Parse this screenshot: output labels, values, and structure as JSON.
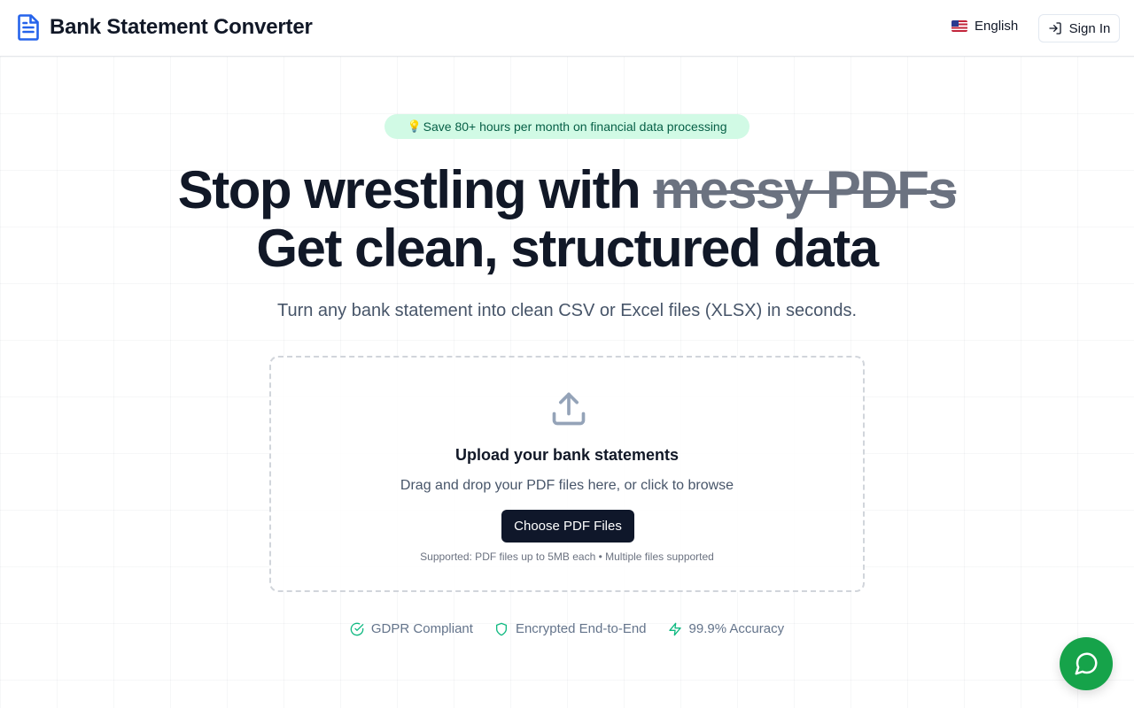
{
  "app": {
    "name": "Bank Statement Converter"
  },
  "header": {
    "language_label": "English",
    "signin_label": "Sign In"
  },
  "hero": {
    "pill_icon": "💡",
    "pill_text": "Save 80+ hours per month on financial data processing",
    "headline_line1_prefix": "Stop wrestling with",
    "headline_line1_strike": "messy PDFs",
    "headline_line2": "Get clean, structured data",
    "subtitle": "Turn any bank statement into clean CSV or Excel files (XLSX) in seconds."
  },
  "upload": {
    "title": "Upload your bank statements",
    "description": "Drag and drop your PDF files here, or click to browse",
    "button_label": "Choose PDF Files",
    "supported_note": "Supported: PDF files up to 5MB each • Multiple files supported"
  },
  "badges": [
    {
      "label": "GDPR Compliant",
      "icon": "check-circle-icon"
    },
    {
      "label": "Encrypted End-to-End",
      "icon": "shield-icon"
    },
    {
      "label": "99.9% Accuracy",
      "icon": "lightning-icon"
    }
  ],
  "colors": {
    "brand": "#2563eb",
    "dark": "#0f172a",
    "pill_bg": "#d1fae5",
    "pill_text": "#065f46",
    "accent_green": "#16a34a"
  }
}
